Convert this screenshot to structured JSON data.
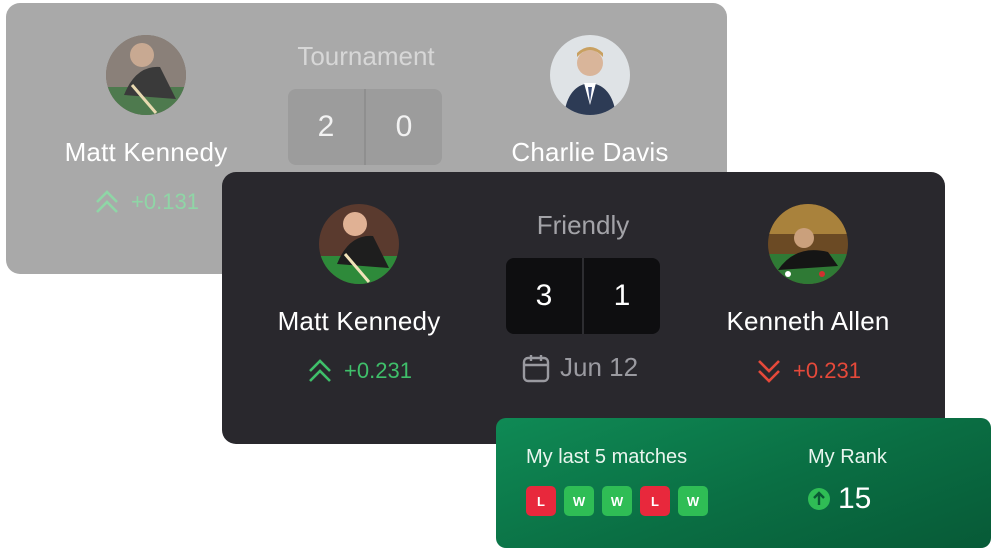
{
  "back_match": {
    "type_label": "Tournament",
    "score_left": "2",
    "score_right": "0",
    "player_left": {
      "name": "Matt Kennedy",
      "delta": "+0.131",
      "trend": "up"
    },
    "player_right": {
      "name": "Charlie Davis"
    }
  },
  "front_match": {
    "type_label": "Friendly",
    "score_left": "3",
    "score_right": "1",
    "date": "Jun 12",
    "player_left": {
      "name": "Matt Kennedy",
      "delta": "+0.231",
      "trend": "up"
    },
    "player_right": {
      "name": "Kenneth Allen",
      "delta": "+0.231",
      "trend": "down"
    }
  },
  "stats": {
    "last_matches_label": "My last 5 matches",
    "results": [
      "L",
      "W",
      "W",
      "L",
      "W"
    ],
    "rank_label": "My Rank",
    "rank_value": "15"
  },
  "colors": {
    "up": "#3fbf6a",
    "down": "#e5493a",
    "loss": "#e8283c",
    "win": "#2fbd55",
    "stats_bg": "#0a7447"
  }
}
